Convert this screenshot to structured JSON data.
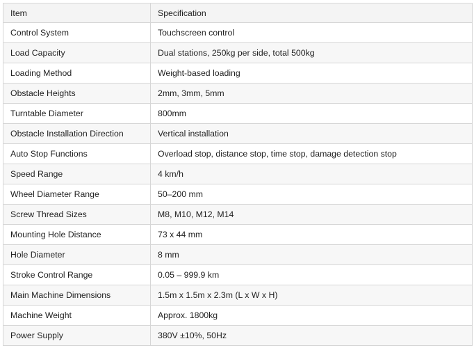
{
  "table": {
    "headers": [
      "Item",
      "Specification"
    ],
    "rows": [
      [
        "Control System",
        "Touchscreen control"
      ],
      [
        "Load Capacity",
        "Dual stations, 250kg per side, total 500kg"
      ],
      [
        "Loading Method",
        "Weight-based loading"
      ],
      [
        "Obstacle Heights",
        "2mm, 3mm, 5mm"
      ],
      [
        "Turntable Diameter",
        "800mm"
      ],
      [
        "Obstacle Installation Direction",
        "Vertical installation"
      ],
      [
        "Auto Stop Functions",
        "Overload stop, distance stop, time stop, damage detection stop"
      ],
      [
        "Speed Range",
        "4 km/h"
      ],
      [
        "Wheel Diameter Range",
        "50–200 mm"
      ],
      [
        "Screw Thread Sizes",
        "M8, M10, M12, M14"
      ],
      [
        "Mounting Hole Distance",
        "73 x 44 mm"
      ],
      [
        "Hole Diameter",
        "8 mm"
      ],
      [
        "Stroke Control Range",
        "0.05 – 999.9 km"
      ],
      [
        "Main Machine Dimensions",
        "1.5m x 1.5m x 2.3m (L x W x H)"
      ],
      [
        "Machine Weight",
        "Approx. 1800kg"
      ],
      [
        "Power Supply",
        "380V ±10%, 50Hz"
      ]
    ]
  }
}
